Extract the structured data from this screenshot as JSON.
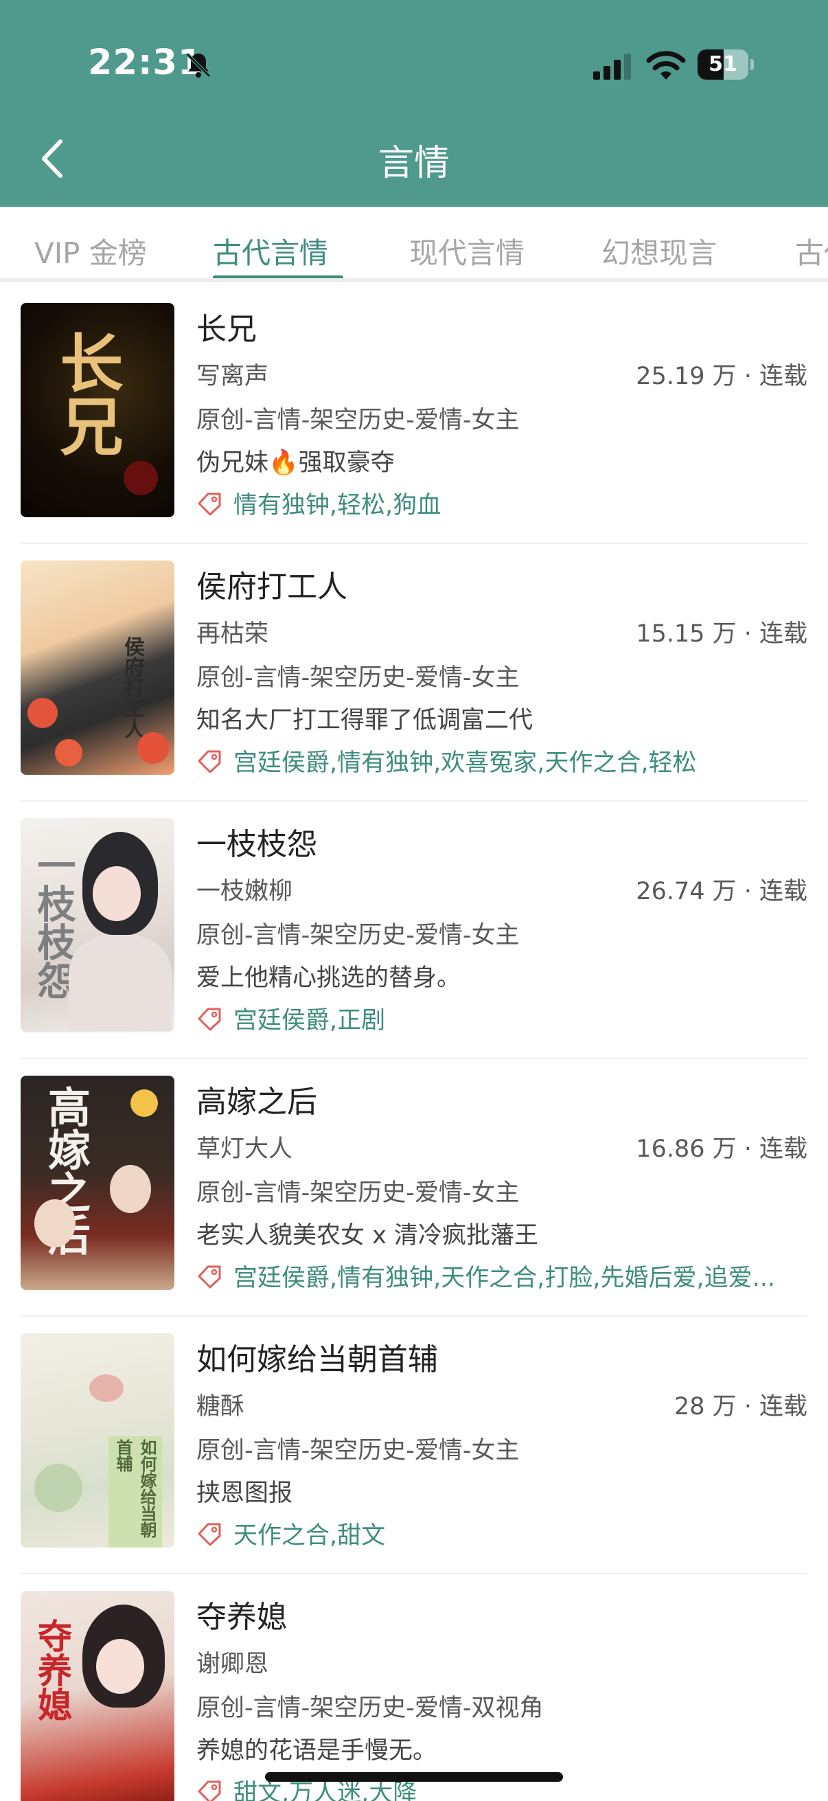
{
  "status_bar": {
    "time": "22:31",
    "battery": "51",
    "battery_level": 0.51
  },
  "header": {
    "title": "言情"
  },
  "tabs": [
    {
      "label": "VIP 金榜",
      "active": false
    },
    {
      "label": "古代言情",
      "active": true
    },
    {
      "label": "现代言情",
      "active": false
    },
    {
      "label": "幻想现言",
      "active": false
    },
    {
      "label": "古代",
      "active": false
    }
  ],
  "books": [
    {
      "title": "长兄",
      "author": "写离声",
      "stats": "25.19 万 · 连载",
      "category": "原创-言情-架空历史-爱情-女主",
      "intro": "伪兄妹🔥强取豪夺",
      "tags": "情有独钟,轻松,狗血",
      "cover_text": "长兄"
    },
    {
      "title": "侯府打工人",
      "author": "再枯荣",
      "stats": "15.15 万 · 连载",
      "category": "原创-言情-架空历史-爱情-女主",
      "intro": "知名大厂打工得罪了低调富二代",
      "tags": "宫廷侯爵,情有独钟,欢喜冤家,天作之合,轻松",
      "cover_text": "侯府打工人"
    },
    {
      "title": "一枝枝怨",
      "author": "一枝嫩柳",
      "stats": "26.74 万 · 连载",
      "category": "原创-言情-架空历史-爱情-女主",
      "intro": "爱上他精心挑选的替身。",
      "tags": "宫廷侯爵,正剧",
      "cover_text": "一枝枝怨"
    },
    {
      "title": "高嫁之后",
      "author": "草灯大人",
      "stats": "16.86 万 · 连载",
      "category": "原创-言情-架空历史-爱情-女主",
      "intro": "老实人貌美农女 x 清冷疯批藩王",
      "tags": "宫廷侯爵,情有独钟,天作之合,打脸,先婚后爱,追爱...",
      "cover_text": "高嫁之后"
    },
    {
      "title": "如何嫁给当朝首辅",
      "author": "糖酥",
      "stats": "28 万 · 连载",
      "category": "原创-言情-架空历史-爱情-女主",
      "intro": "挟恩图报",
      "tags": "天作之合,甜文",
      "cover_text": "如何嫁给当朝首辅"
    },
    {
      "title": "夺养媳",
      "author": "谢卿恩",
      "stats": "",
      "category": "原创-言情-架空历史-爱情-双视角",
      "intro": "养媳的花语是手慢无。",
      "tags": "甜文,万人迷,大降",
      "cover_text": "夺养媳"
    }
  ],
  "colors": {
    "header_bg": "#4f9a8d",
    "accent": "#3e8d7f"
  }
}
